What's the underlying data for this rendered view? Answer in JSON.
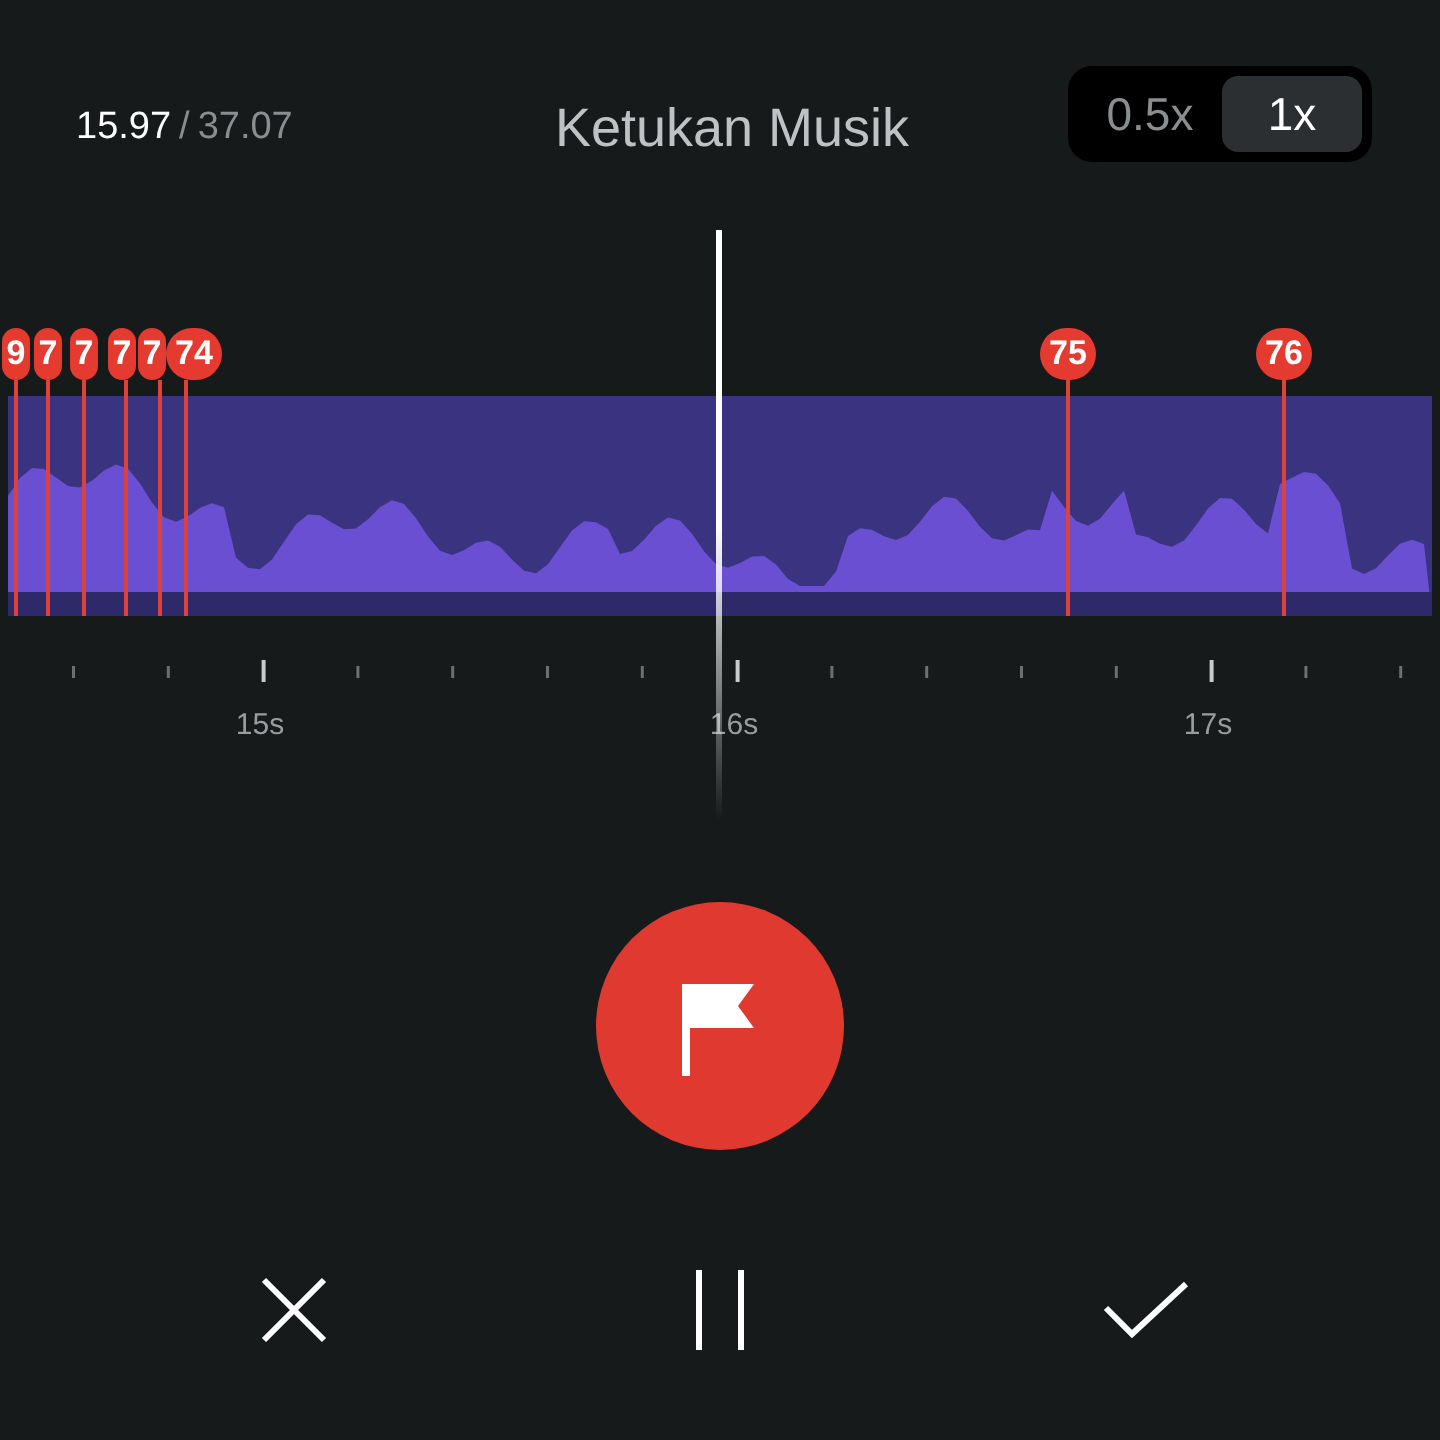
{
  "header": {
    "time_current": "15.97",
    "time_separator": "/",
    "time_total": "37.07",
    "title": "Ketukan Musik"
  },
  "speed_options": [
    {
      "label": "0.5x",
      "selected": false
    },
    {
      "label": "1x",
      "selected": true
    }
  ],
  "beat_markers": [
    {
      "label": "9"
    },
    {
      "label": "7"
    },
    {
      "label": "7"
    },
    {
      "label": "7"
    },
    {
      "label": "7"
    },
    {
      "label": "74"
    },
    {
      "label": "75"
    },
    {
      "label": "76"
    }
  ],
  "ruler_labels": [
    "15s",
    "16s",
    "17s"
  ]
}
